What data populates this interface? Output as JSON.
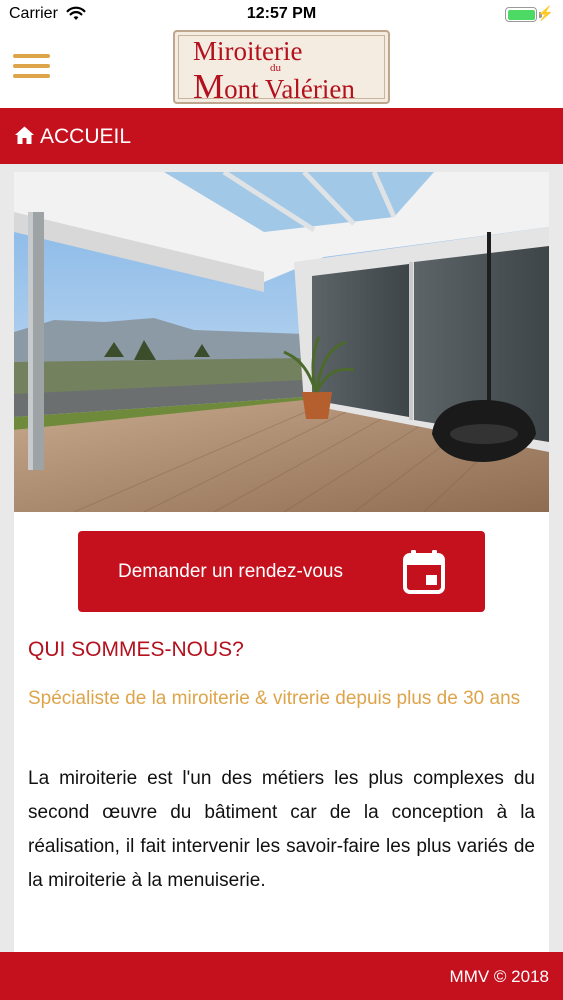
{
  "status_bar": {
    "carrier": "Carrier",
    "time": "12:57 PM",
    "battery_level": 1.0
  },
  "header": {
    "logo": {
      "line1": "Miroiterie",
      "du": "du",
      "mont_initial": "M",
      "mont_rest": "ont Valérien"
    },
    "menu_icon": "hamburger-icon"
  },
  "title_bar": {
    "icon": "home-icon",
    "title": "ACCUEIL"
  },
  "main": {
    "cta_label": "Demander un rendez-vous",
    "cta_icon": "calendar-icon",
    "section_title": "QUI SOMMES-NOUS?",
    "section_subtitle": "Spécialiste de la miroiterie & vitrerie depuis plus de 30 ans",
    "section_body": "La miroiterie est l'un des métiers les plus complexes du second œuvre du bâtiment car de la conception à la réalisation, il fait intervenir les savoir-faire les plus variés de la miroiterie à la menuiserie."
  },
  "footer": {
    "text": "MMV © 2018"
  },
  "colors": {
    "brand_red": "#c5101e",
    "accent_gold": "#dea44a",
    "title_red": "#b3111d",
    "page_bg": "#e9e9ea"
  }
}
